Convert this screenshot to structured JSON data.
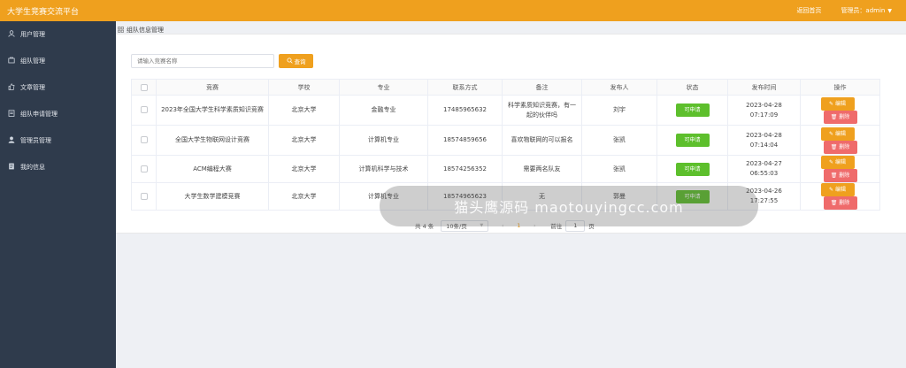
{
  "app": {
    "title": "大学生竞赛交流平台",
    "home_link": "返回首页",
    "admin_label": "管理员：admin",
    "accent_color": "#efa01e"
  },
  "sidebar": {
    "items": [
      {
        "icon": "user-icon",
        "label": "用户管理"
      },
      {
        "icon": "team-icon",
        "label": "组队管理"
      },
      {
        "icon": "thumb-up-icon",
        "label": "文章管理"
      },
      {
        "icon": "application-icon",
        "label": "组队申请管理"
      },
      {
        "icon": "admin-icon",
        "label": "管理员管理"
      },
      {
        "icon": "info-icon",
        "label": "我的信息"
      }
    ]
  },
  "breadcrumb": {
    "label": "组队信息管理"
  },
  "search": {
    "placeholder": "请输入竞赛名称",
    "button_label": "查询"
  },
  "table": {
    "headers": [
      "竞赛",
      "学校",
      "专业",
      "联系方式",
      "备注",
      "发布人",
      "状态",
      "发布时间",
      "操作"
    ],
    "rows": [
      {
        "competition": "2023年全国大学生科学素质知识竞赛",
        "school": "北京大学",
        "major": "金融专业",
        "contact": "17485965632",
        "note": "科学素质知识竞赛，有一起的伙伴吗",
        "publisher": "刘宇",
        "status": "可申请",
        "time": "2023-04-28 07:17:09",
        "edit_label": "编辑",
        "delete_label": "删除"
      },
      {
        "competition": "全国大学生物联网设计竞赛",
        "school": "北京大学",
        "major": "计算机专业",
        "contact": "18574859656",
        "note": "喜欢物联网的可以报名",
        "publisher": "张凯",
        "status": "可申请",
        "time": "2023-04-28 07:14:04",
        "edit_label": "编辑",
        "delete_label": "删除"
      },
      {
        "competition": "ACM编程大赛",
        "school": "北京大学",
        "major": "计算机科学与技术",
        "contact": "18574256352",
        "note": "需要两名队友",
        "publisher": "张凯",
        "status": "可申请",
        "time": "2023-04-27 06:55:03",
        "edit_label": "编辑",
        "delete_label": "删除"
      },
      {
        "competition": "大学生数学建模竞赛",
        "school": "北京大学",
        "major": "计算机专业",
        "contact": "18574965623",
        "note": "无",
        "publisher": "郭曼",
        "status": "可申请",
        "time": "2023-04-26 17:27:55",
        "edit_label": "编辑",
        "delete_label": "删除"
      }
    ]
  },
  "pagination": {
    "total": "共 4 条",
    "page_size": "10条/页",
    "current_page": "1",
    "goto_label": "前往",
    "goto_value": "1",
    "page_unit": "页"
  },
  "watermark": {
    "text": "猫头鹰源码 maotouyingcc.com"
  }
}
